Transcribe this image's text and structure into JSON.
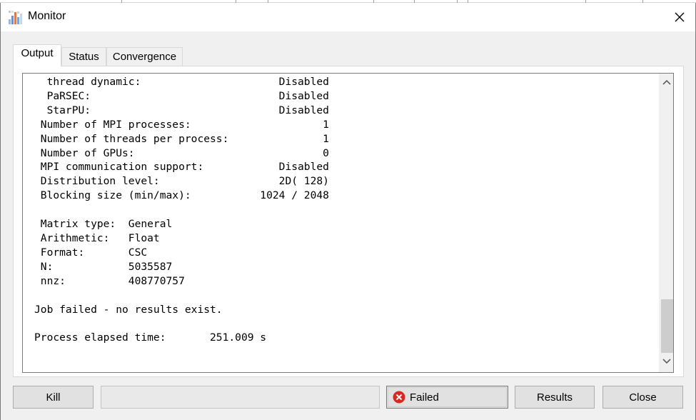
{
  "window": {
    "title": "Monitor"
  },
  "tabs": [
    {
      "label": "Output",
      "active": true
    },
    {
      "label": "Status",
      "active": false
    },
    {
      "label": "Convergence",
      "active": false
    }
  ],
  "output": {
    "lines": [
      "  thread dynamic:                      Disabled",
      "  PaRSEC:                              Disabled",
      "  StarPU:                              Disabled",
      " Number of MPI processes:                     1",
      " Number of threads per process:               1",
      " Number of GPUs:                              0",
      " MPI communication support:            Disabled",
      " Distribution level:                   2D( 128)",
      " Blocking size (min/max):           1024 / 2048",
      "",
      " Matrix type:  General",
      " Arithmetic:   Float",
      " Format:       CSC",
      " N:            5035587",
      " nnz:          408770757",
      "",
      "Job failed - no results exist.",
      "",
      "Process elapsed time:       251.009 s"
    ]
  },
  "buttons": {
    "kill": "Kill",
    "status": "",
    "failed": "Failed",
    "results": "Results",
    "close": "Close"
  },
  "colors": {
    "failed_icon": "#d9281f",
    "tab_border": "#d9d9d9",
    "scroll_thumb": "#cdcdcd"
  },
  "icons": {
    "app": "monitor-app-icon",
    "close": "close-icon",
    "failed": "error-circle-icon"
  }
}
